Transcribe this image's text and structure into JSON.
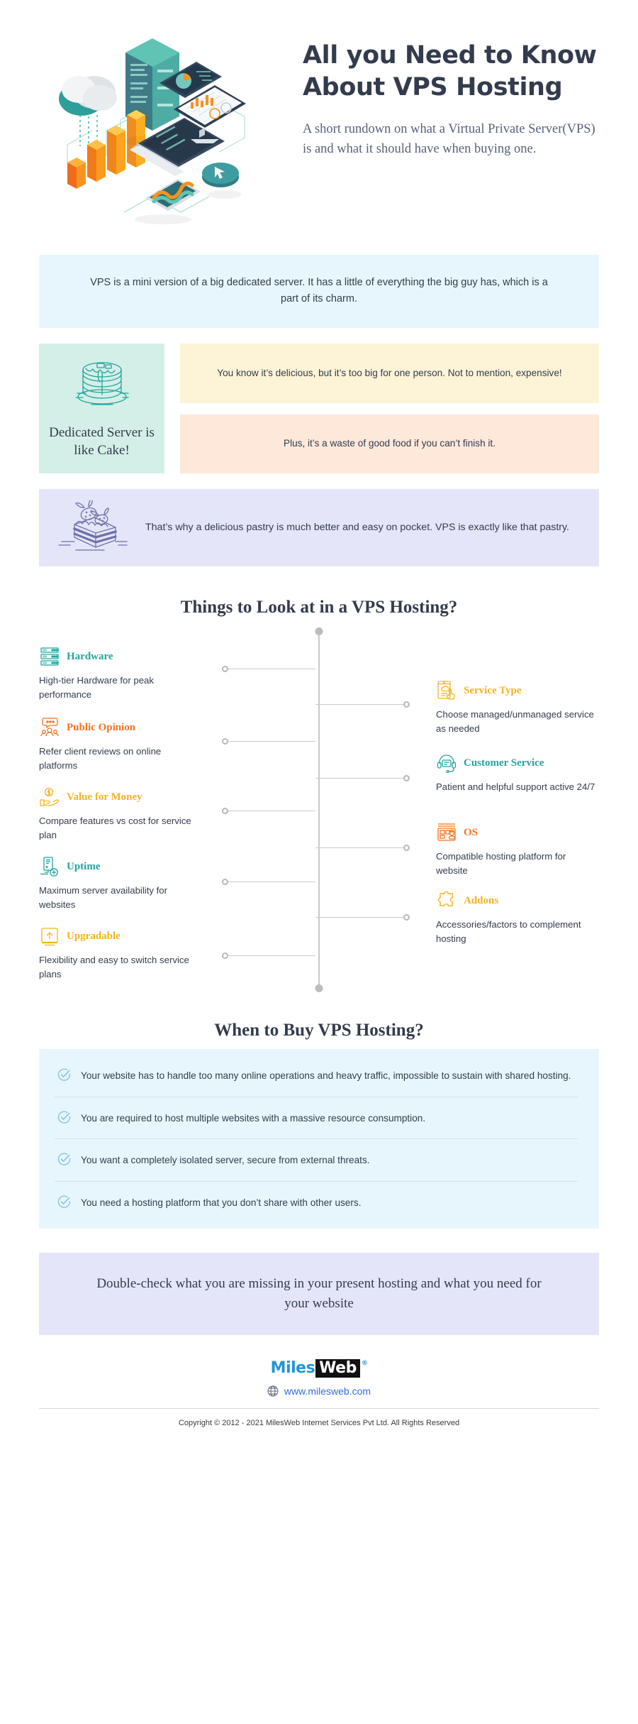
{
  "hero": {
    "title": "All you Need to Know About VPS Hosting",
    "subtitle": "A short rundown on what a Virtual Private Server(VPS) is and what it should have when buying one.",
    "art_icon": "isometric-server-analytics-illustration"
  },
  "intro": {
    "text": "VPS is a mini version of a big dedicated server. It has a little of everything the big guy has, which is a part of its charm."
  },
  "cake": {
    "card_label": "Dedicated Server is like Cake!",
    "card_icon": "layer-cake-icon",
    "note_1": "You know it’s delicious, but it’s too big for one person. Not to mention, expensive!",
    "note_2": "Plus, it’s a waste of good food if you can’t finish it."
  },
  "pastry": {
    "icon": "cake-slice-icon",
    "text": "That’s why a delicious pastry is much better and easy on pocket. VPS is exactly like that pastry."
  },
  "sections": {
    "things_heading": "Things to Look at in a VPS Hosting?",
    "when_heading": "When to Buy VPS Hosting?"
  },
  "features": [
    {
      "side": "left",
      "title": "Hardware",
      "desc": "High-tier Hardware for peak performance",
      "color": "#21a4a0",
      "icon": "server-rack-icon"
    },
    {
      "side": "right",
      "title": "Service Type",
      "desc": "Choose managed/unmanaged service as needed",
      "color": "#f5b31d",
      "icon": "tablet-cloud-tap-icon"
    },
    {
      "side": "left",
      "title": "Public Opinion",
      "desc": "Refer client reviews on online platforms",
      "color": "#f37321",
      "icon": "people-review-icon"
    },
    {
      "side": "right",
      "title": "Customer Service",
      "desc": "Patient and helpful support active 24/7",
      "color": "#21a4a0",
      "icon": "headset-support-icon"
    },
    {
      "side": "left",
      "title": "Value for Money",
      "desc": "Compare features vs cost for service plan",
      "color": "#f5b31d",
      "icon": "hand-coin-icon"
    },
    {
      "side": "right",
      "title": "OS",
      "desc": "Compatible hosting platform for website",
      "color": "#f37321",
      "icon": "operating-system-icon"
    },
    {
      "side": "left",
      "title": "Uptime",
      "desc": "Maximum server availability for websites",
      "color": "#21a4a0",
      "icon": "server-uptime-icon"
    },
    {
      "side": "right",
      "title": "Addons",
      "desc": "Accessories/factors to complement hosting",
      "color": "#f5b31d",
      "icon": "puzzle-piece-icon"
    },
    {
      "side": "left",
      "title": "Upgradable",
      "desc": "Flexibility and easy to switch service plans",
      "color": "#f5b31d",
      "icon": "upgrade-box-icon"
    }
  ],
  "checklist": [
    {
      "icon": "check-circle-icon",
      "text": "Your website has to handle too many online operations and heavy traffic, impossible to sustain with shared hosting."
    },
    {
      "icon": "check-circle-icon",
      "text": "You are required to host multiple websites with a massive resource consumption."
    },
    {
      "icon": "check-circle-icon",
      "text": "You want a completely isolated server, secure from external threats."
    },
    {
      "icon": "check-circle-icon",
      "text": "You need a hosting platform that you don’t share with other users."
    }
  ],
  "closing": {
    "text": "Double-check what you are missing in your present hosting and what you need for your website"
  },
  "footer": {
    "logo_miles": "Miles",
    "logo_web": "Web",
    "logo_reg": "®",
    "website_icon": "globe-icon",
    "website": "www.milesweb.com",
    "copyright": "Copyright © 2012 - 2021 MilesWeb Internet Services Pvt Ltd. All Rights Reserved"
  },
  "colors": {
    "teal": "#21a4a0",
    "orange": "#f37321",
    "yellow": "#f5b31d",
    "ink": "#333c4e",
    "band_blue": "#e7f6fd",
    "band_mint": "#d4efe7",
    "band_yellow": "#fdf3d7",
    "band_peach": "#fde8da",
    "band_lavender": "#e4e5f8",
    "link_blue": "#2f6fe0"
  }
}
